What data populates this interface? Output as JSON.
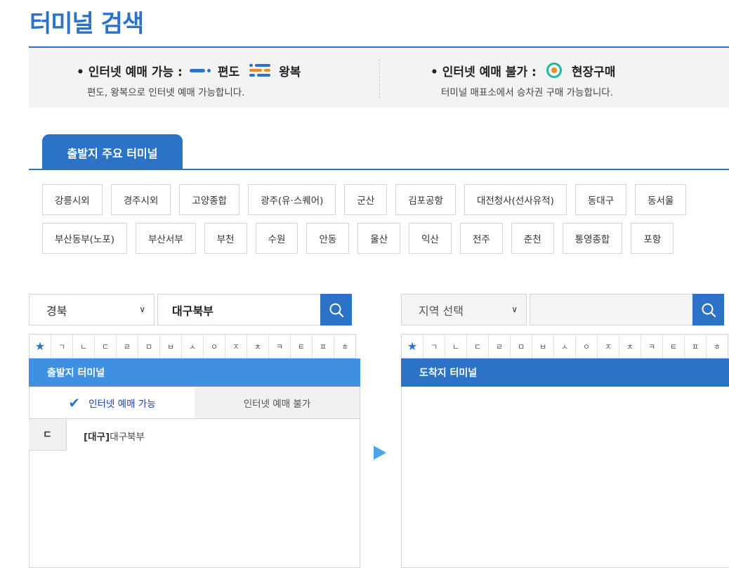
{
  "page": {
    "title": "터미널 검색"
  },
  "legend": {
    "available": {
      "label": "• 인터넷 예매 가능 :",
      "oneway": "편도",
      "roundtrip": "왕복",
      "desc": "편도, 왕복으로 인터넷 예매 가능합니다."
    },
    "unavailable": {
      "label": "• 인터넷 예매 불가 :",
      "onsite": "현장구매",
      "desc": "터미널 매표소에서 승차권 구매 가능합니다."
    }
  },
  "tabs": {
    "major": "출발지 주요 터미널"
  },
  "major_terminals": {
    "row1": [
      "강릉시외",
      "경주시외",
      "고양종합",
      "광주(유·스퀘어)",
      "군산",
      "김포공항",
      "대전청사(선사유적)",
      "동대구",
      "동서울"
    ],
    "row2": [
      "부산동부(노포)",
      "부산서부",
      "부천",
      "수원",
      "안동",
      "울산",
      "익산",
      "전주",
      "춘천",
      "통영종합",
      "포항"
    ]
  },
  "departure": {
    "region": "경북",
    "search_value": "대구북부",
    "header": "출발지 터미널",
    "tab_available": "인터넷 예매 가능",
    "tab_unavailable": "인터넷 예매 불가",
    "results": [
      {
        "initial": "ㄷ",
        "region": "[대구]",
        "name": "대구북부"
      }
    ]
  },
  "arrival": {
    "region": "지역 선택",
    "search_value": "",
    "header": "도착지 터미널"
  },
  "consonants": [
    "★",
    "ㄱ",
    "ㄴ",
    "ㄷ",
    "ㄹ",
    "ㅁ",
    "ㅂ",
    "ㅅ",
    "ㅇ",
    "ㅈ",
    "ㅊ",
    "ㅋ",
    "ㅌ",
    "ㅍ",
    "ㅎ"
  ],
  "icons": {
    "search": "search-icon",
    "chevron": "chevron-down-icon",
    "check": "check-icon",
    "arrow": "arrow-right-icon",
    "star": "star-icon"
  },
  "colors": {
    "primary": "#2c73c8",
    "header_light": "#3f8fe3",
    "accent_orange": "#f28b1e",
    "accent_teal": "#1cb8a5"
  }
}
